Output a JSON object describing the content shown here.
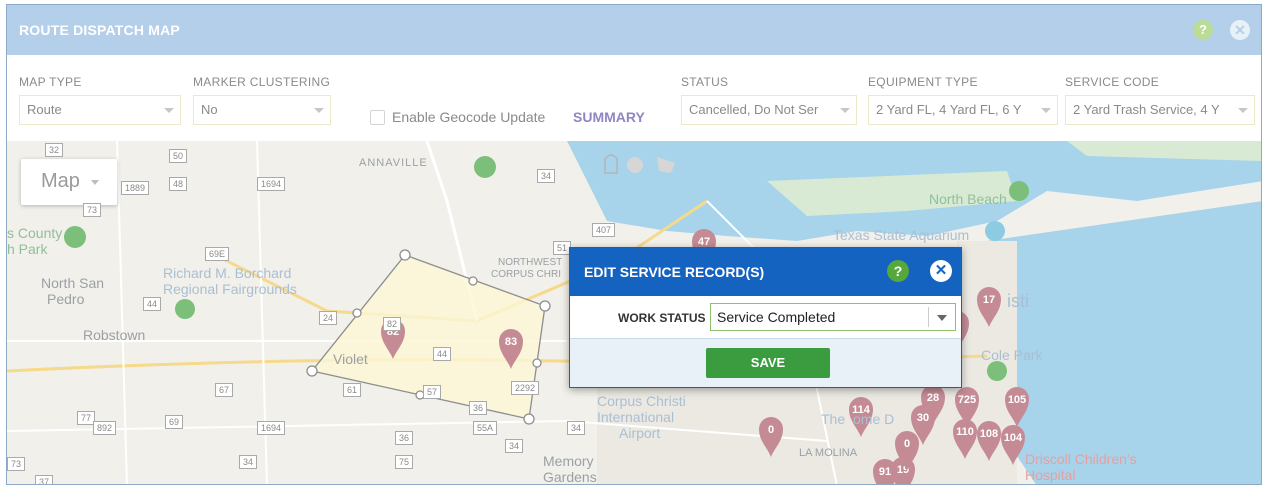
{
  "window": {
    "title": "ROUTE DISPATCH MAP",
    "help_glyph": "?",
    "close_glyph": "✕"
  },
  "filters": {
    "map_type": {
      "label": "MAP TYPE",
      "value": "Route"
    },
    "marker_clustering": {
      "label": "MARKER CLUSTERING",
      "value": "No"
    },
    "geocode": {
      "label": "Enable Geocode Update",
      "checked": false
    },
    "summary_link": "SUMMARY",
    "status": {
      "label": "STATUS",
      "value": "Cancelled, Do Not Ser"
    },
    "equipment_type": {
      "label": "EQUIPMENT TYPE",
      "value": "2 Yard FL, 4 Yard FL, 6 Y"
    },
    "service_code": {
      "label": "SERVICE CODE",
      "value": "2 Yard Trash Service, 4 Y"
    }
  },
  "map": {
    "type_control": "Map",
    "place_labels": [
      "ANNAVILLE",
      "North San",
      "Pedro",
      "Robstown",
      "Richard M. Borchard",
      "Regional Fairgrounds",
      "Violet",
      "s County",
      "h Park",
      "North Beach",
      "Texas State Aquarium",
      "Corpus Christi",
      "International",
      "Airport",
      "Memory",
      "Gardens",
      "LA MOLINA",
      "Cole Park",
      "Driscoll Children's",
      "Hospital",
      "NORTHWEST",
      "CORPUS CHRI",
      "isti",
      "The",
      "ome D"
    ],
    "road_labels": [
      "32",
      "50",
      "1889",
      "48",
      "1694",
      "73",
      "69E",
      "44",
      "24",
      "82",
      "44",
      "67",
      "61",
      "57",
      "2292",
      "36",
      "55A",
      "77",
      "892",
      "69",
      "1694",
      "36",
      "34",
      "34",
      "75",
      "73",
      "37",
      "407",
      "51",
      "34",
      "34"
    ],
    "markers": [
      "47",
      "82",
      "83",
      "0",
      "114",
      "725",
      "105",
      "110",
      "108",
      "104",
      "91",
      "19",
      "0",
      "17",
      "0",
      "28",
      "30"
    ],
    "colors": {
      "marker": "#c48b95",
      "route": "#8d8d8d",
      "water": "#a7d3eb"
    }
  },
  "modal": {
    "title": "EDIT SERVICE RECORD(S)",
    "help_glyph": "?",
    "close_glyph": "✕",
    "work_status_label": "WORK STATUS",
    "work_status_value": "Service Completed",
    "save_label": "SAVE"
  }
}
